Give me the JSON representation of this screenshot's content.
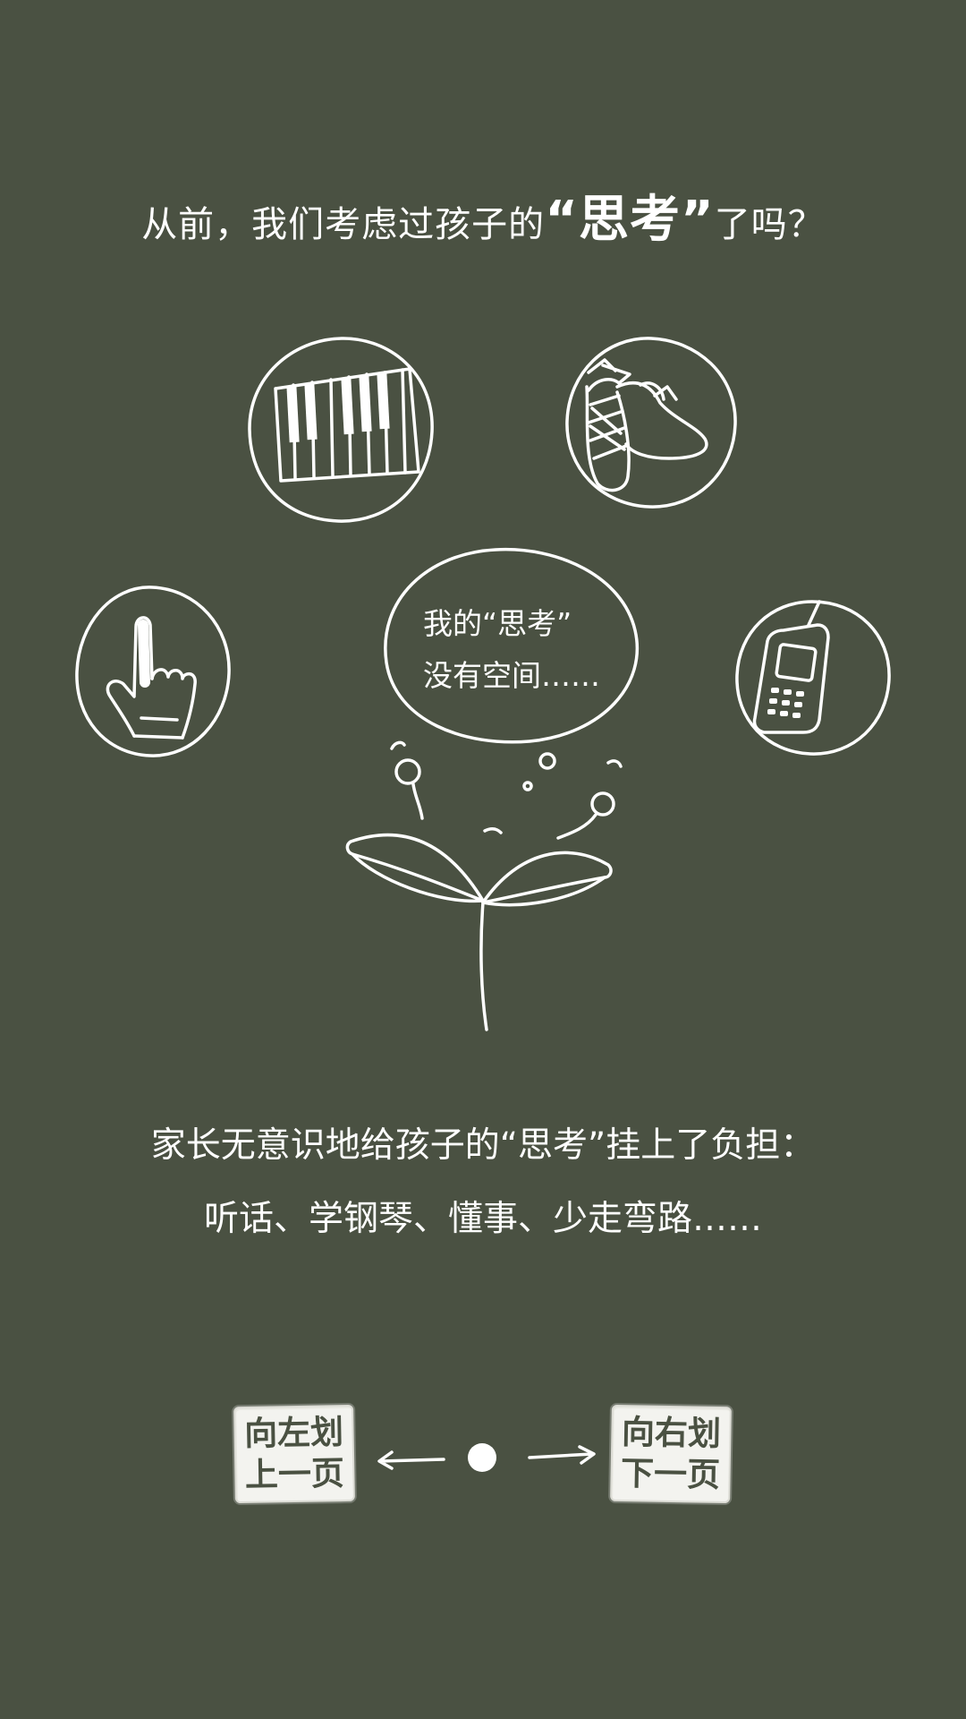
{
  "headline": {
    "before": "从前，我们考虑过孩子的",
    "emphasis": "“思考”",
    "after": "了吗？"
  },
  "bubble": {
    "line1": "我的“思考”",
    "line2": "没有空间……"
  },
  "burden": {
    "line1": "家长无意识地给孩子的“思考”挂上了负担：",
    "line2": "听话、学钢琴、懂事、少走弯路……"
  },
  "nav": {
    "prev_line1": "向左划",
    "prev_line2": "上一页",
    "next_line1": "向右划",
    "next_line2": "下一页"
  },
  "icons": [
    "piano-keys-icon",
    "ballet-shoes-icon",
    "pointing-finger-icon",
    "mobile-phone-icon",
    "sprout-icon",
    "thought-bubble-icon",
    "swipe-dot-icon"
  ],
  "colors": {
    "background": "#4a5142",
    "chalk": "#ffffff"
  }
}
